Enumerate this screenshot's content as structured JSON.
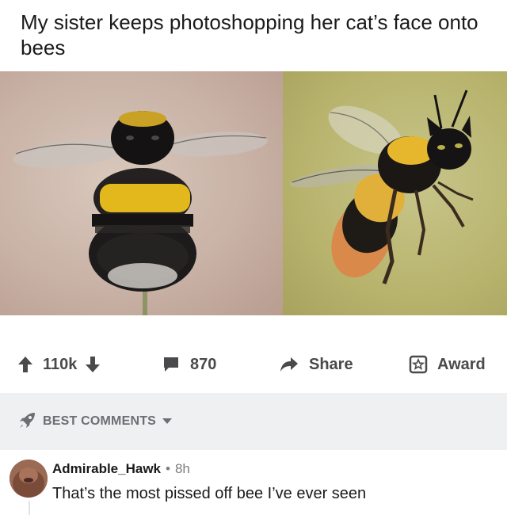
{
  "post": {
    "title": "My sister keeps photoshopping her cat’s face onto bees"
  },
  "actions": {
    "vote_count": "110k",
    "comment_count": "870",
    "share_label": "Share",
    "award_label": "Award"
  },
  "comments_section": {
    "sort_label": "BEST COMMENTS"
  },
  "comment": {
    "author": "Admirable_Hawk",
    "separator": "•",
    "time": "8h",
    "body": "That’s the most pissed off bee I’ve ever seen"
  },
  "colors": {
    "text": "#1a1a1b",
    "muted": "#6b6f73",
    "section_bg": "#eef0f2",
    "bee_yellow": "#e3b81c"
  },
  "icons": [
    "upvote-icon",
    "downvote-icon",
    "comment-icon",
    "share-icon",
    "award-icon",
    "rocket-icon",
    "caret-down-icon"
  ]
}
